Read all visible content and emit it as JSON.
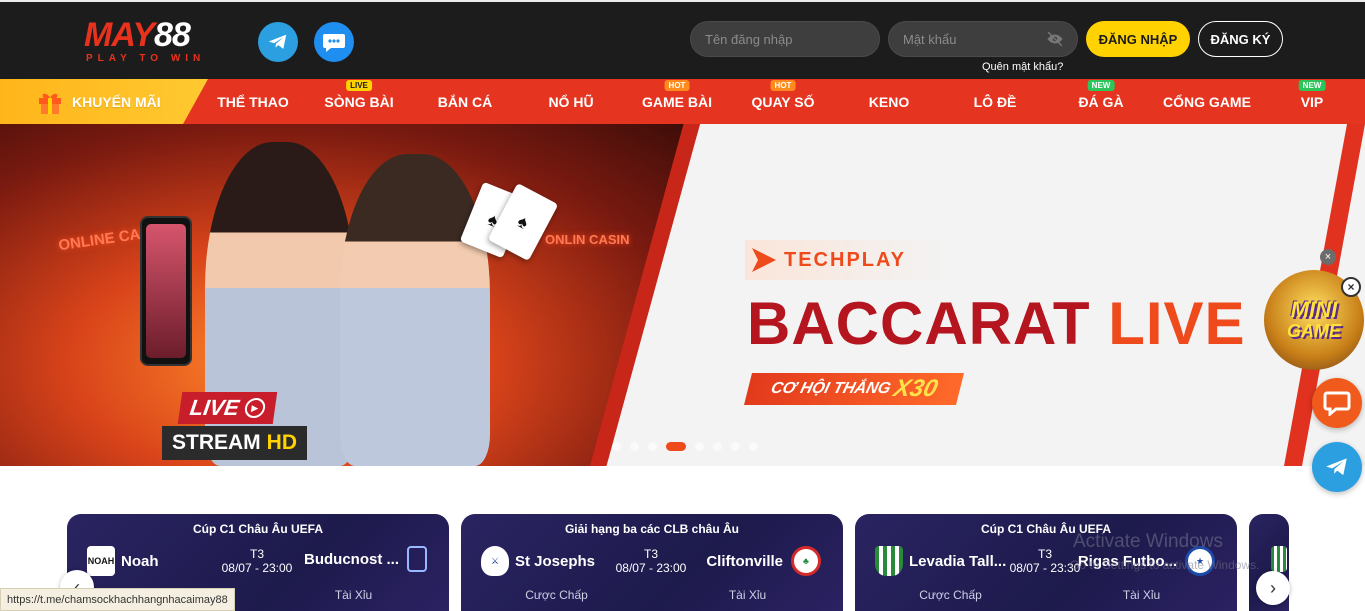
{
  "brand": {
    "logo_main": "MAY88",
    "tagline": "PLAY TO WIN"
  },
  "header": {
    "username_placeholder": "Tên đăng nhập",
    "password_placeholder": "Mật khẩu",
    "forgot_password": "Quên mật khẩu?",
    "login_label": "ĐĂNG NHẬP",
    "register_label": "ĐĂNG KÝ"
  },
  "nav": {
    "promo": "KHUYẾN MÃI",
    "items": [
      {
        "label": "THỂ THAO",
        "badge": ""
      },
      {
        "label": "SÒNG BÀI",
        "badge": "LIVE"
      },
      {
        "label": "BẮN CÁ",
        "badge": ""
      },
      {
        "label": "NỔ HŨ",
        "badge": ""
      },
      {
        "label": "GAME BÀI",
        "badge": "HOT"
      },
      {
        "label": "QUAY SỐ",
        "badge": "HOT"
      },
      {
        "label": "KENO",
        "badge": ""
      },
      {
        "label": "LÔ ĐỀ",
        "badge": ""
      },
      {
        "label": "ĐÁ GÀ",
        "badge": "NEW"
      },
      {
        "label": "CỔNG GAME",
        "badge": ""
      },
      {
        "label": "VIP",
        "badge": "NEW"
      }
    ]
  },
  "banner": {
    "sign_left": "ONLINE CASINO",
    "sign_right": "ONLIN CASIN",
    "live": "LIVE",
    "stream": "STREAM",
    "hd": "HD",
    "provider": "TECHPLAY",
    "title_part1": "BACCARAT",
    "title_part2": "LIVE",
    "chance": "CƠ HỘI THẮNG",
    "multiplier": "X30",
    "slide_count": 8,
    "active_slide": 4
  },
  "widgets": {
    "minigame_line1": "MINI",
    "minigame_line2": "GAME",
    "close": "×"
  },
  "matches": [
    {
      "league": "Cúp C1 Châu Âu UEFA",
      "home": "Noah",
      "away": "Buducnost ...",
      "round": "T3",
      "datetime": "08/07 - 23:00",
      "bet1": "",
      "bet2": "Tài Xỉu",
      "home_crest": "NOAH"
    },
    {
      "league": "Giải hạng ba các CLB châu Âu",
      "home": "St Josephs",
      "away": "Cliftonville",
      "round": "T3",
      "datetime": "08/07 - 23:00",
      "bet1": "Cược Chấp",
      "bet2": "Tài Xỉu",
      "home_crest": ""
    },
    {
      "league": "Cúp C1 Châu Âu UEFA",
      "home": "Levadia Tall...",
      "away": "Rigas Futbo...",
      "round": "T3",
      "datetime": "08/07 - 23:30",
      "bet1": "Cược Chấp",
      "bet2": "Tài Xỉu",
      "home_crest": ""
    }
  ],
  "status_url": "https://t.me/chamsockhachhangnhacaimay88",
  "watermark": {
    "title": "Activate Windows",
    "subtitle": "Go to Settings to activate Windows."
  },
  "colors": {
    "header_bg": "#1c1c1c",
    "nav_bg": "#e53521",
    "login_yellow": "#ffd200",
    "card_bg": "#1d1a4c",
    "brand_red": "#e8321e"
  }
}
